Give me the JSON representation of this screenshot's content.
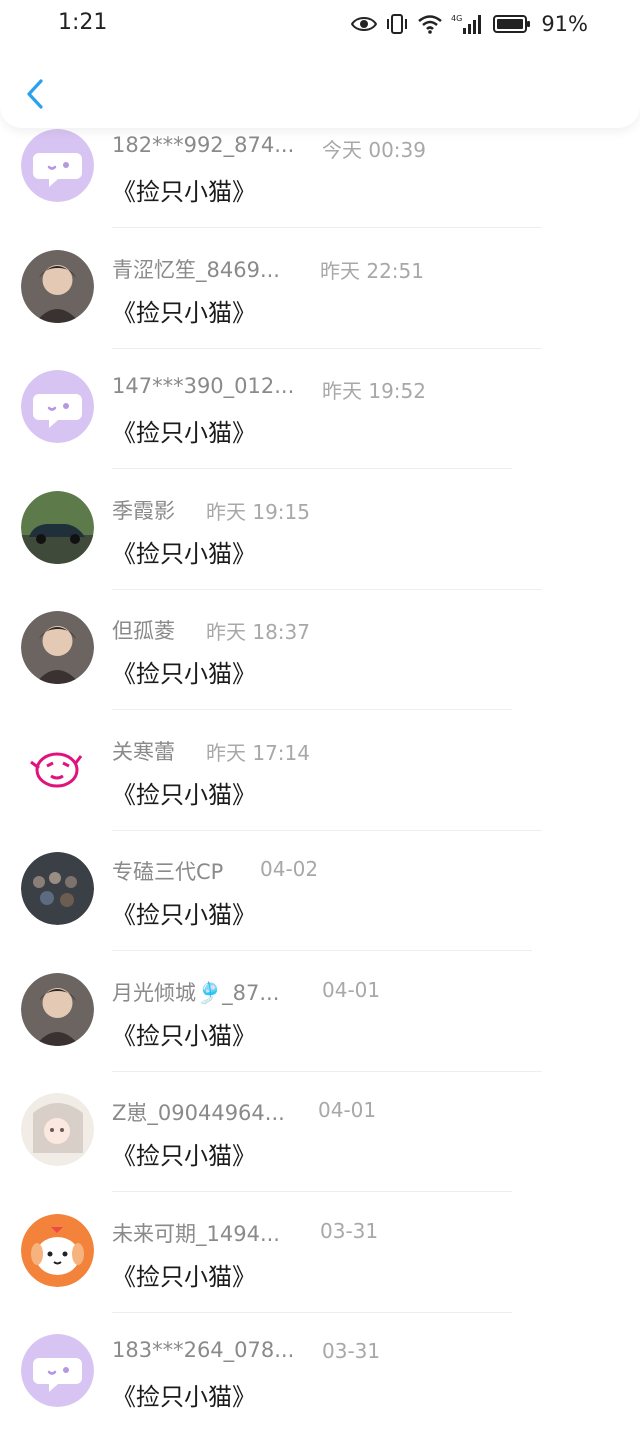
{
  "status_bar": {
    "time": "1:21",
    "battery": "91%",
    "icons": [
      "eye-icon",
      "vibrate-icon",
      "wifi-icon",
      "4g-signal-icon",
      "battery-icon"
    ],
    "network_label": "4G"
  },
  "header": {
    "back_icon": "chevron-left-icon",
    "accent_color": "#2aa1f0"
  },
  "messages": [
    {
      "name": "182***992_874...",
      "time": "今天 00:39",
      "text": "《捡只小猫》",
      "avatar": "default-chat-avatar"
    },
    {
      "name": "青涩忆笙_8469...",
      "time": "昨天 22:51",
      "text": "《捡只小猫》",
      "avatar": "photo-avatar"
    },
    {
      "name": "147***390_012...",
      "time": "昨天 19:52",
      "text": "《捡只小猫》",
      "avatar": "default-chat-avatar"
    },
    {
      "name": "季霞影",
      "time": "昨天 19:15",
      "text": "《捡只小猫》",
      "avatar": "car-photo-avatar"
    },
    {
      "name": "但孤菱",
      "time": "昨天 18:37",
      "text": "《捡只小猫》",
      "avatar": "photo-avatar"
    },
    {
      "name": "关寒蕾",
      "time": "昨天 17:14",
      "text": "《捡只小猫》",
      "avatar": "cartoon-avatar"
    },
    {
      "name": "专磕三代CP",
      "time": "04-02",
      "text": "《捡只小猫》",
      "avatar": "crowd-photo-avatar"
    },
    {
      "name": "月光倾城🎐_87...",
      "time": "04-01",
      "text": "《捡只小猫》",
      "avatar": "photo-avatar"
    },
    {
      "name": "Z崽_09044964...",
      "time": "04-01",
      "text": "《捡只小猫》",
      "avatar": "anime-avatar"
    },
    {
      "name": "未来可期_1494...",
      "time": "03-31",
      "text": "《捡只小猫》",
      "avatar": "cartoon-dog-avatar"
    },
    {
      "name": "183***264_078...",
      "time": "03-31",
      "text": "《捡只小猫》",
      "avatar": "default-chat-avatar"
    }
  ]
}
